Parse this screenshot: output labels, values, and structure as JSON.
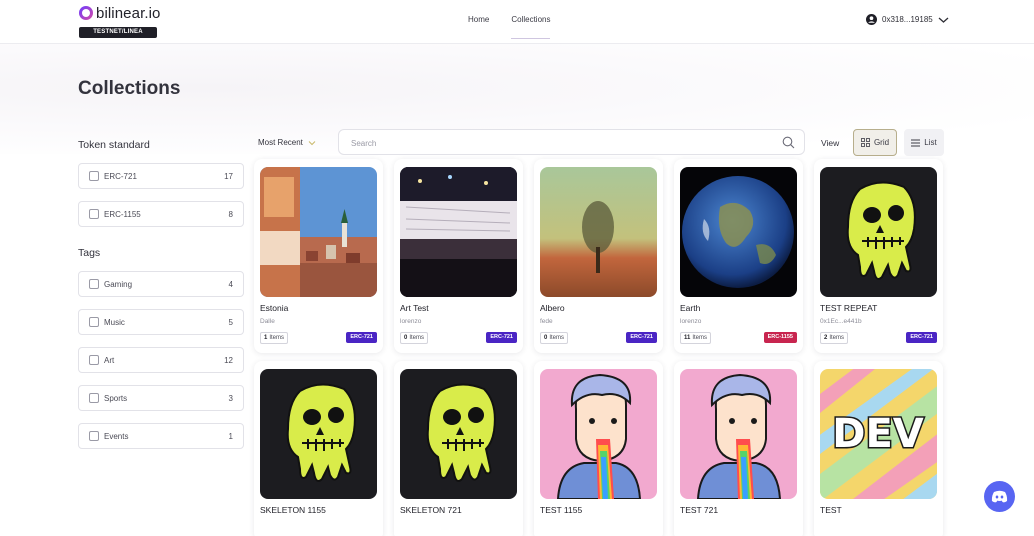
{
  "header": {
    "logo_text": "bilinear.io",
    "network_badge": "TESTNET/LINEA",
    "nav": [
      {
        "label": "Home",
        "active": false
      },
      {
        "label": "Collections",
        "active": true
      }
    ],
    "wallet_address": "0x318...19185"
  },
  "page": {
    "title": "Collections"
  },
  "sidebar": {
    "token_standard_heading": "Token standard",
    "token_standards": [
      {
        "label": "ERC-721",
        "count": "17"
      },
      {
        "label": "ERC-1155",
        "count": "8"
      }
    ],
    "tags_heading": "Tags",
    "tags": [
      {
        "label": "Gaming",
        "count": "4"
      },
      {
        "label": "Music",
        "count": "5"
      },
      {
        "label": "Art",
        "count": "12"
      },
      {
        "label": "Sports",
        "count": "3"
      },
      {
        "label": "Events",
        "count": "1"
      }
    ]
  },
  "toolbar": {
    "sort_label": "Most Recent",
    "search_placeholder": "Search",
    "view_label": "View",
    "grid_label": "Grid",
    "list_label": "List"
  },
  "colors": {
    "erc721_badge": "#4a25c4",
    "erc1155_badge": "#c8254f",
    "accent": "#b7ae8c",
    "discord": "#5865f2"
  },
  "collections": [
    {
      "name": "Estonia",
      "creator": "Dalle",
      "items_count": "1",
      "items_label": "Items",
      "standard": "ERC-721",
      "image": "estonia-photo"
    },
    {
      "name": "Art Test",
      "creator": "lorenzo",
      "items_count": "0",
      "items_label": "Items",
      "standard": "ERC-721",
      "image": "exhibition-photo"
    },
    {
      "name": "Albero",
      "creator": "fede",
      "items_count": "0",
      "items_label": "Items",
      "standard": "ERC-721",
      "image": "tree-painting"
    },
    {
      "name": "Earth",
      "creator": "lorenzo",
      "items_count": "11",
      "items_label": "Items",
      "standard": "ERC-1155",
      "image": "earth-photo"
    },
    {
      "name": "TEST REPEAT",
      "creator": "0x1Ec...e441b",
      "items_count": "2",
      "items_label": "Items",
      "standard": "ERC-721",
      "image": "ape-skull"
    },
    {
      "name": "SKELETON 1155",
      "image": "ape-skull"
    },
    {
      "name": "SKELETON 721",
      "image": "ape-skull"
    },
    {
      "name": "TEST 1155",
      "image": "rainbow-boy"
    },
    {
      "name": "TEST 721",
      "image": "rainbow-boy"
    },
    {
      "name": "TEST",
      "image": "dev-stripes",
      "image_text": "DEV"
    }
  ]
}
